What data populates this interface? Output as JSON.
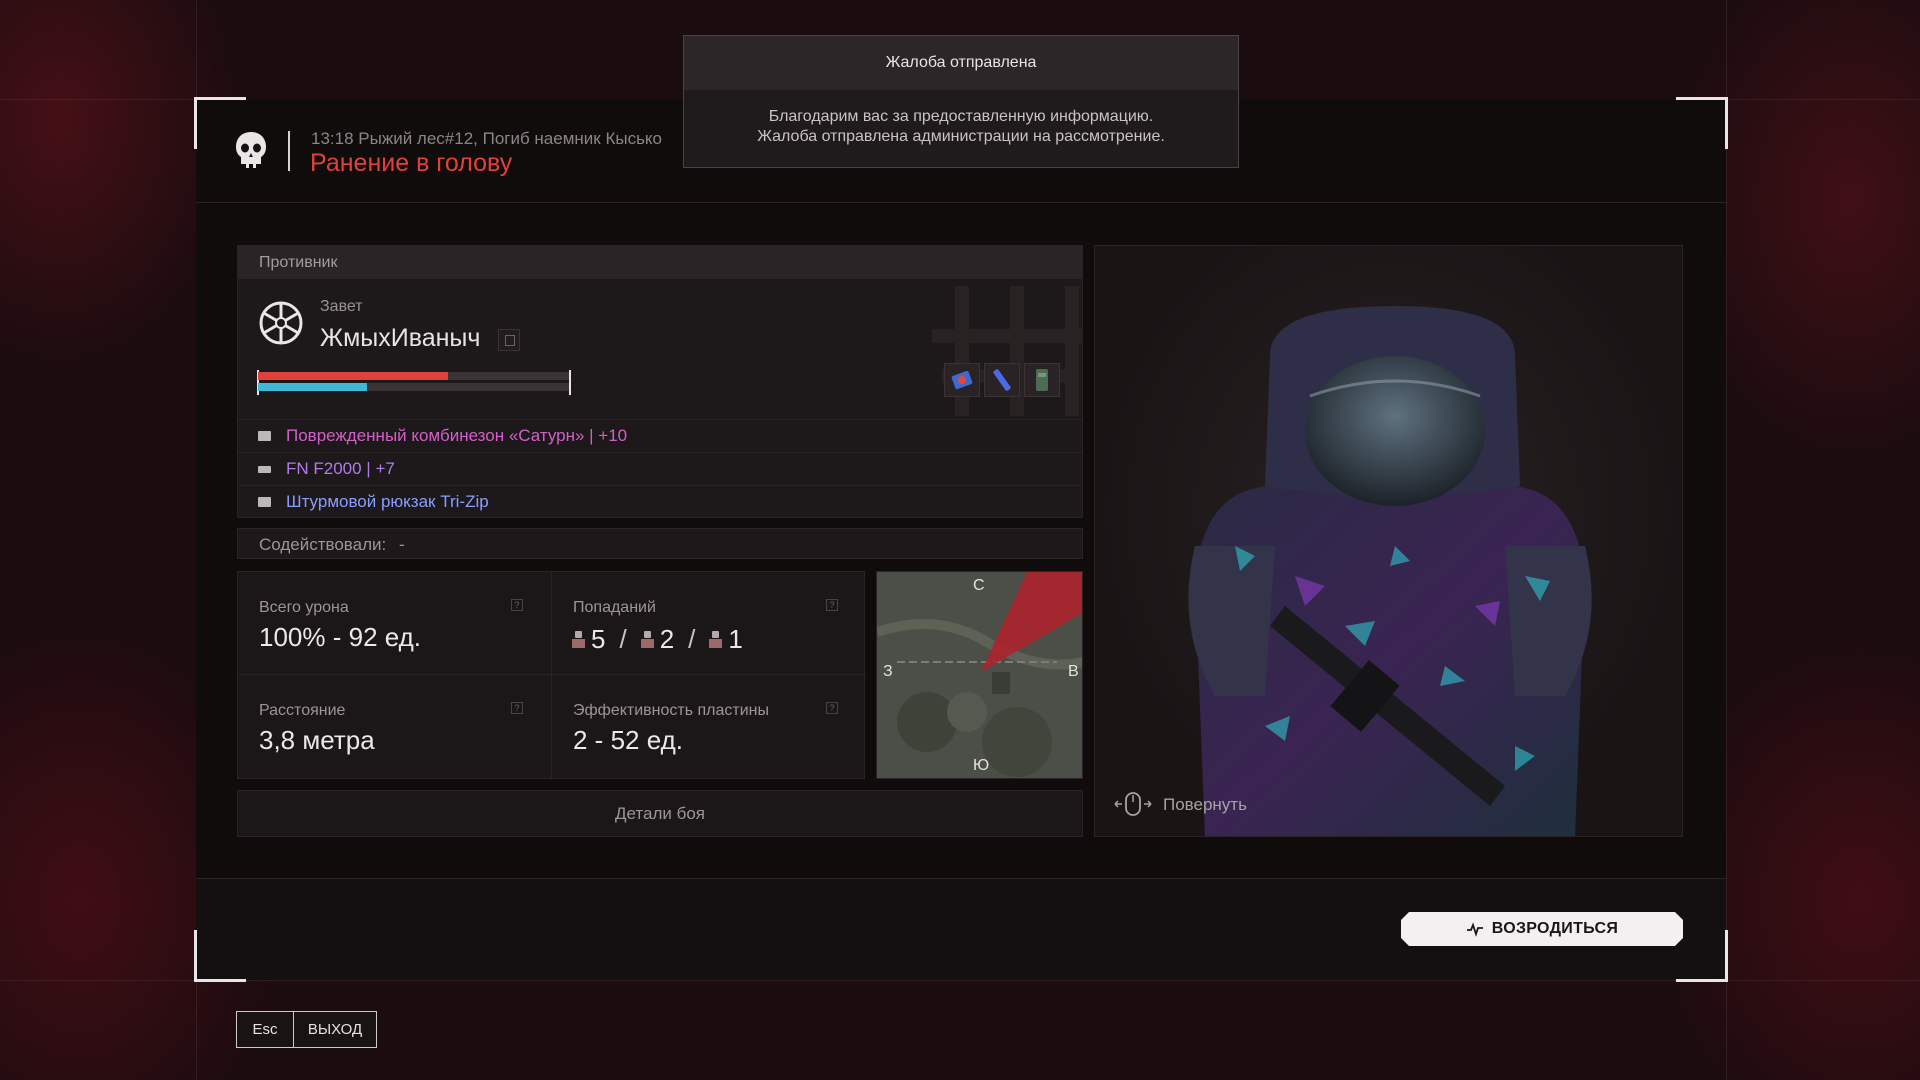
{
  "header": {
    "meta": "13:18 Рыжий лес#12, Погиб наемник Кысько",
    "title": "Ранение в голову"
  },
  "enemy": {
    "section_title": "Противник",
    "faction": "Завет",
    "name": "ЖмыхИваныч",
    "health_fraction": 0.61,
    "armor_fraction": 0.35,
    "equipment": [
      {
        "icon": "armor-icon",
        "label": "Поврежденный комбинезон «Сатурн» | +10",
        "color": "#d45fcb"
      },
      {
        "icon": "rifle-icon",
        "label": "FN F2000 | +7",
        "color": "#b07ce8"
      },
      {
        "icon": "backpack-icon",
        "label": "Штурмовой рюкзак Tri-Zip",
        "color": "#8a9dff"
      }
    ],
    "quick_slots": [
      "medkit-icon",
      "syringe-icon",
      "canister-icon"
    ]
  },
  "assist": {
    "label": "Содействовали:",
    "value": "-"
  },
  "stats": {
    "total_damage_label": "Всего урона",
    "total_damage_value": "100% - 92 ед.",
    "hits_label": "Попаданий",
    "hits": [
      "5",
      "2",
      "1"
    ],
    "distance_label": "Расстояние",
    "distance_value": "3,8 метра",
    "plate_label": "Эффективность пластины",
    "plate_value": "2 - 52 ед.",
    "help_glyph": "?"
  },
  "minimap": {
    "north": "С",
    "south": "Ю",
    "west": "З",
    "east": "В"
  },
  "details_button": "Детали боя",
  "model": {
    "rotate_label": "Повернуть"
  },
  "respawn_button": "ВОЗРОДИТЬСЯ",
  "exit": {
    "key": "Esc",
    "label": "ВЫХОД"
  },
  "toast": {
    "title": "Жалоба отправлена",
    "line1": "Благодарим вас за предоставленную информацию.",
    "line2": "Жалоба отправлена администрации на рассмотрение."
  },
  "colors": {
    "accent_red": "#e0413c",
    "health_bar": "#e0413c",
    "armor_bar": "#3fb8d8"
  }
}
